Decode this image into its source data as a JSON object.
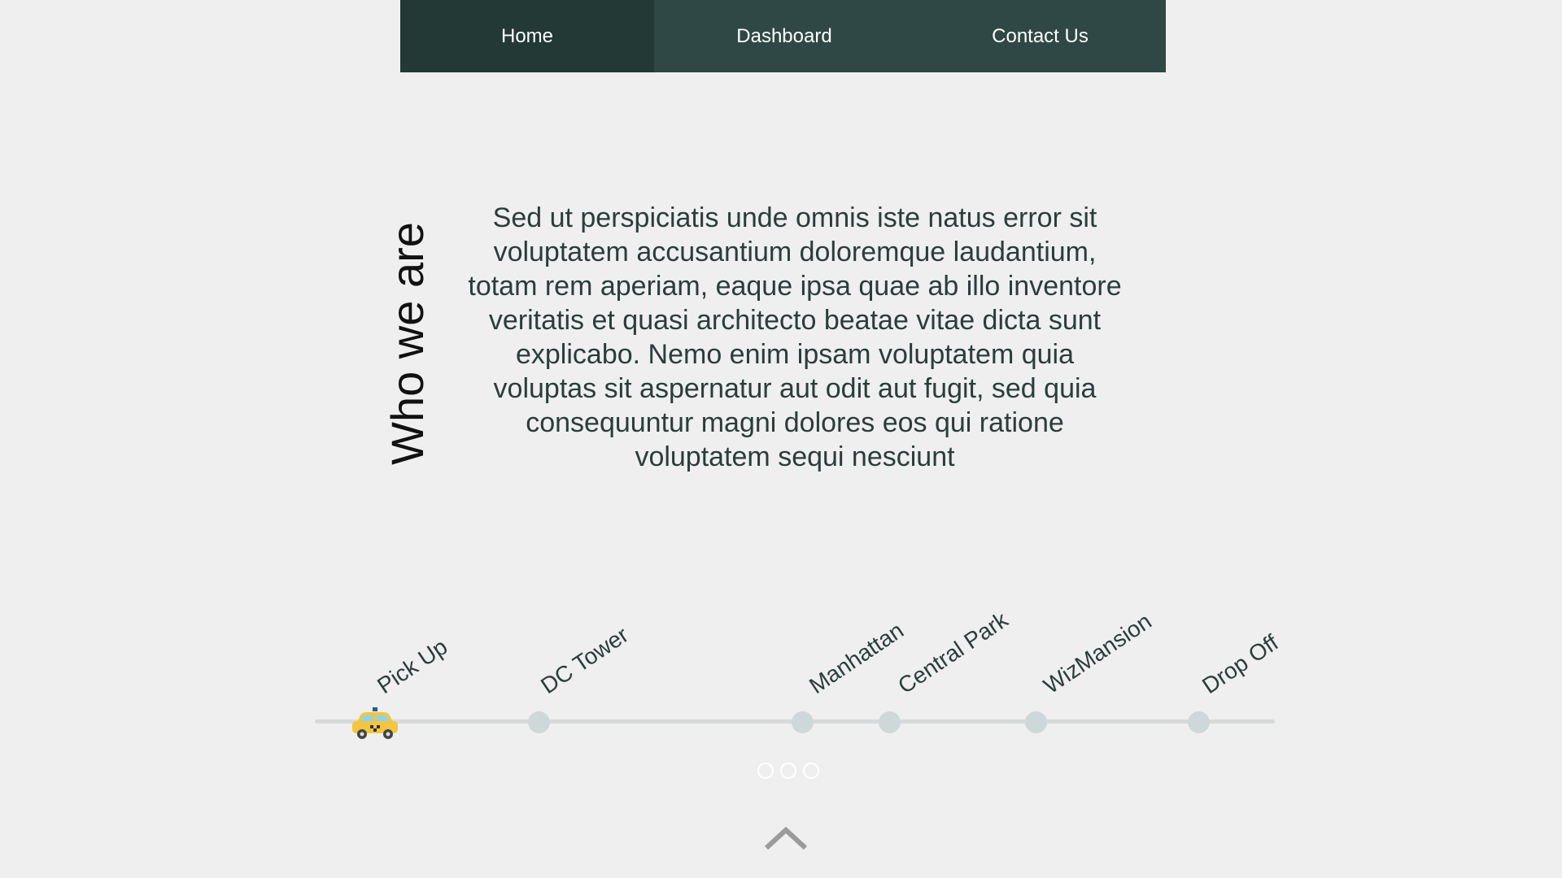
{
  "nav": {
    "items": [
      {
        "label": "Home"
      },
      {
        "label": "Dashboard"
      },
      {
        "label": "Contact Us"
      }
    ]
  },
  "about": {
    "heading": "Who we are",
    "paragraph": "Sed ut perspiciatis unde omnis iste natus error sit voluptatem accusantium doloremque laudantium, totam rem aperiam, eaque ipsa quae ab illo inventore veritatis et quasi architecto beatae vitae dicta sunt explicabo. Nemo enim ipsam voluptatem quia voluptas sit aspernatur aut odit aut fugit, sed quia consequuntur magni dolores eos qui ratione voluptatem sequi nesciunt"
  },
  "timeline": {
    "stops": [
      {
        "label": "Pick Up"
      },
      {
        "label": "DC Tower"
      },
      {
        "label": "Manhattan"
      },
      {
        "label": "Central Park"
      },
      {
        "label": "WizMansion"
      },
      {
        "label": "Drop Off"
      }
    ],
    "vehicle_icon": "taxi-icon"
  },
  "pager": {
    "count": 3
  },
  "icons": {
    "scroll_top": "chevron-up-icon"
  },
  "colors": {
    "nav_bg": "#2f4845",
    "nav_active": "#223936",
    "background": "#efefef",
    "stop": "#cfd8d9"
  }
}
